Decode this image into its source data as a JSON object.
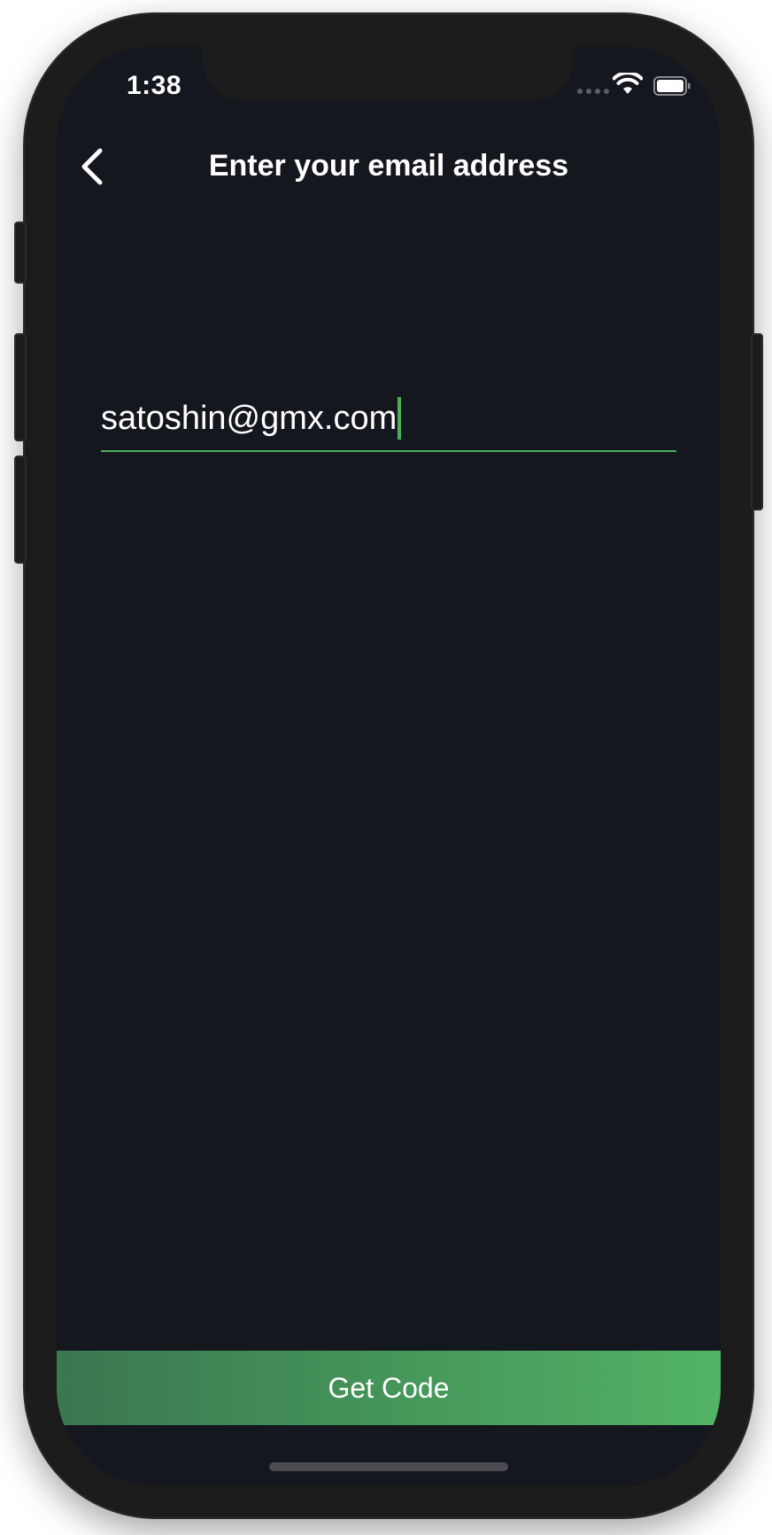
{
  "status_bar": {
    "time": "1:38",
    "signal_icon": "cellular-signal-icon",
    "wifi_icon": "wifi-icon",
    "battery_icon": "battery-icon"
  },
  "nav": {
    "back_icon": "chevron-left-icon",
    "title": "Enter your email address"
  },
  "form": {
    "email_value": "satoshin@gmx.com"
  },
  "cta": {
    "label": "Get Code"
  },
  "colors": {
    "background": "#15171e",
    "accent": "#4caf5c",
    "button_gradient_start": "#3b774f",
    "button_gradient_end": "#52b464",
    "text": "#ffffff"
  }
}
